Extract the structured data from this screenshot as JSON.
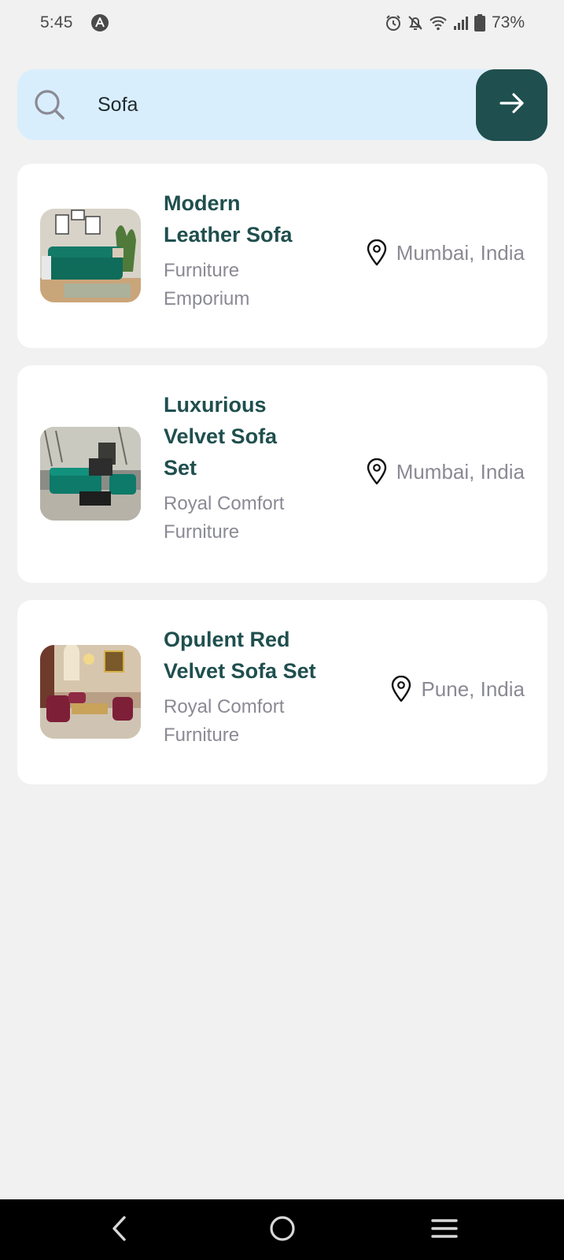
{
  "status_bar": {
    "time": "5:45",
    "battery": "73%"
  },
  "search": {
    "value": "Sofa",
    "placeholder": "Search"
  },
  "results": [
    {
      "title_line1": "Modern",
      "title_line2": "Leather Sofa",
      "title_line3": "",
      "seller_line1": "Furniture",
      "seller_line2": "Emporium",
      "location": "Mumbai, India"
    },
    {
      "title_line1": "Luxurious",
      "title_line2": "Velvet Sofa",
      "title_line3": "Set",
      "seller_line1": "Royal Comfort",
      "seller_line2": "Furniture",
      "location": "Mumbai, India"
    },
    {
      "title_line1": "Opulent Red",
      "title_line2": "Velvet Sofa Set",
      "title_line3": "",
      "seller_line1": "Royal Comfort",
      "seller_line2": "Furniture",
      "location": "Pune, India"
    }
  ],
  "colors": {
    "accent": "#1f4f4e",
    "search_bg": "#d9eefc",
    "muted_text": "#8a8a94",
    "background": "#f1f1f1"
  },
  "icons": {
    "search": "search-icon",
    "go": "arrow-right-icon",
    "location": "map-pin-icon",
    "nav_back": "back-chevron-icon",
    "nav_home": "home-circle-icon",
    "nav_recents": "menu-lines-icon"
  }
}
